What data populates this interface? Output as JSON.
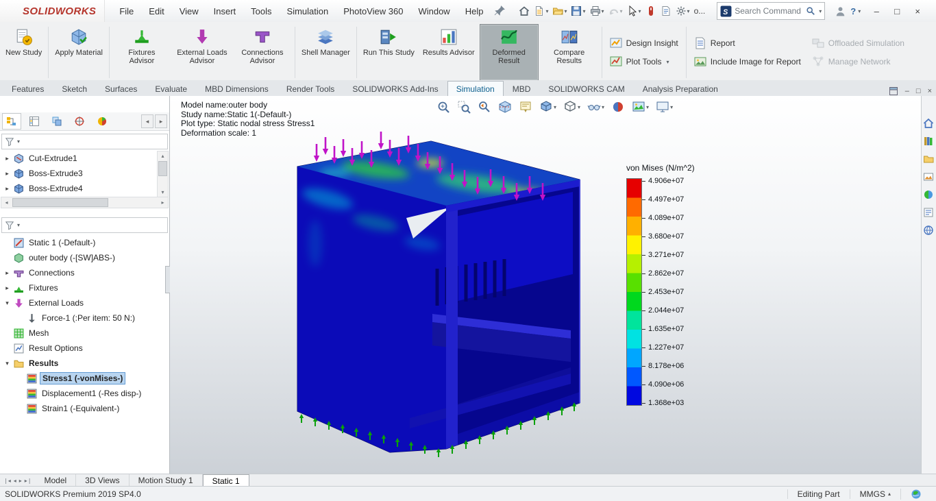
{
  "titlebar": {
    "brand": "SOLIDWORKS",
    "menu": [
      "File",
      "Edit",
      "View",
      "Insert",
      "Tools",
      "Simulation",
      "PhotoView 360",
      "Window",
      "Help"
    ],
    "quick_access": [
      {
        "icon": "home-icon",
        "name": "home-button"
      },
      {
        "icon": "new-doc-icon",
        "name": "new-document-button",
        "dropdown": true
      },
      {
        "icon": "open-icon",
        "name": "open-button",
        "dropdown": true
      },
      {
        "icon": "save-icon",
        "name": "save-button",
        "dropdown": true
      },
      {
        "icon": "print-icon",
        "name": "print-button",
        "dropdown": true
      },
      {
        "icon": "undo-icon",
        "name": "undo-button",
        "dropdown": true,
        "disabled": true
      },
      {
        "icon": "select-cursor-icon",
        "name": "select-button",
        "dropdown": true
      },
      {
        "icon": "mouse-gesture-icon",
        "name": "mouse-gestures-button"
      },
      {
        "icon": "doc-props-icon",
        "name": "file-properties-button"
      },
      {
        "icon": "gear-icon",
        "name": "options-button",
        "dropdown": true
      },
      {
        "label": "o...",
        "name": "options-overflow-button"
      }
    ],
    "search_placeholder": "Search Command"
  },
  "ribbon": {
    "large_buttons": [
      {
        "label": "New Study",
        "icon": "new-study-icon"
      },
      {
        "label": "Apply Material",
        "icon": "apply-material-icon"
      },
      {
        "label": "Fixtures Advisor",
        "icon": "fixtures-advisor-icon"
      },
      {
        "label": "External Loads Advisor",
        "icon": "external-loads-icon"
      },
      {
        "label": "Connections Advisor",
        "icon": "connections-advisor-icon"
      },
      {
        "label": "Shell Manager",
        "icon": "shell-manager-icon"
      },
      {
        "label": "Run This Study",
        "icon": "run-study-icon"
      },
      {
        "label": "Results Advisor",
        "icon": "results-advisor-icon"
      },
      {
        "label": "Deformed Result",
        "icon": "deformed-result-icon",
        "active": true
      },
      {
        "label": "Compare Results",
        "icon": "compare-results-icon"
      }
    ],
    "small_columns": [
      [
        {
          "label": "Design Insight",
          "icon": "design-insight-icon"
        },
        {
          "label": "Plot Tools",
          "icon": "plot-tools-icon",
          "dropdown": true
        }
      ],
      [
        {
          "label": "Report",
          "icon": "report-icon"
        },
        {
          "label": "Include Image for Report",
          "icon": "include-image-icon"
        }
      ],
      [
        {
          "label": "Offloaded Simulation",
          "icon": "offloaded-sim-icon",
          "disabled": true
        },
        {
          "label": "Manage Network",
          "icon": "manage-network-icon",
          "disabled": true
        }
      ]
    ]
  },
  "tabs": {
    "items": [
      "Features",
      "Sketch",
      "Surfaces",
      "Evaluate",
      "MBD Dimensions",
      "Render Tools",
      "SOLIDWORKS Add-Ins",
      "Simulation",
      "MBD",
      "SOLIDWORKS CAM",
      "Analysis Preparation"
    ],
    "active": "Simulation"
  },
  "panel": {
    "tab_icons": [
      "featuremanager-icon",
      "propertymanager-icon",
      "configurationmanager-icon",
      "dimxpert-icon",
      "displaymanager-icon"
    ],
    "feature_tree": [
      {
        "label": "Cut-Extrude1",
        "icon": "cut-extrude-icon",
        "expander": "collapsed"
      },
      {
        "label": "Boss-Extrude3",
        "icon": "boss-extrude-icon",
        "expander": "collapsed"
      },
      {
        "label": "Boss-Extrude4",
        "icon": "boss-extrude-icon",
        "expander": "collapsed"
      }
    ],
    "study_tree": [
      {
        "label": "Static 1 (-Default-)",
        "icon": "study-icon",
        "level": 0,
        "expander": "none"
      },
      {
        "label": "outer body (-[SW]ABS-)",
        "icon": "part-icon",
        "level": 0,
        "expander": "none"
      },
      {
        "label": "Connections",
        "icon": "connections-icon",
        "level": 0,
        "expander": "collapsed"
      },
      {
        "label": "Fixtures",
        "icon": "fixtures-icon",
        "level": 0,
        "expander": "collapsed"
      },
      {
        "label": "External Loads",
        "icon": "external-loads-tree-icon",
        "level": 0,
        "expander": "expanded"
      },
      {
        "label": "Force-1 (:Per item: 50 N:)",
        "icon": "force-icon",
        "level": 1,
        "expander": "none"
      },
      {
        "label": "Mesh",
        "icon": "mesh-icon",
        "level": 0,
        "expander": "none"
      },
      {
        "label": "Result Options",
        "icon": "result-options-icon",
        "level": 0,
        "expander": "none"
      },
      {
        "label": "Results",
        "icon": "results-folder-icon",
        "level": 0,
        "expander": "expanded",
        "bold": true
      },
      {
        "label": "Stress1 (-vonMises-)",
        "icon": "stress-plot-icon",
        "level": 1,
        "expander": "none",
        "selected": true,
        "bold": true
      },
      {
        "label": "Displacement1 (-Res disp-)",
        "icon": "displacement-plot-icon",
        "level": 1,
        "expander": "none"
      },
      {
        "label": "Strain1 (-Equivalent-)",
        "icon": "strain-plot-icon",
        "level": 1,
        "expander": "none"
      }
    ]
  },
  "viewport": {
    "model_info": [
      "Model name:outer body",
      "Study name:Static 1(-Default-)",
      "Plot type: Static nodal stress Stress1",
      "Deformation scale: 1"
    ],
    "toolbar": [
      {
        "icon": "zoom-fit-icon",
        "name": "zoom-to-fit-button"
      },
      {
        "icon": "zoom-area-icon",
        "name": "zoom-to-area-button"
      },
      {
        "icon": "previous-view-icon",
        "name": "previous-view-button"
      },
      {
        "icon": "section-view-icon",
        "name": "section-view-button"
      },
      {
        "icon": "dynamic-annotation-icon",
        "name": "annotation-views-button"
      },
      {
        "icon": "view-orientation-icon",
        "name": "view-orientation-button",
        "dropdown": true
      },
      {
        "icon": "display-style-icon",
        "name": "display-style-button",
        "dropdown": true
      },
      {
        "icon": "hide-show-icon",
        "name": "hide-show-items-button",
        "dropdown": true
      },
      {
        "icon": "edit-appearance-icon",
        "name": "edit-appearance-button"
      },
      {
        "icon": "apply-scene-icon",
        "name": "apply-scene-button",
        "dropdown": true
      },
      {
        "icon": "view-settings-icon",
        "name": "view-settings-button",
        "dropdown": true
      }
    ],
    "legend": {
      "title": "von Mises (N/m^2)",
      "values": [
        "4.906e+07",
        "4.497e+07",
        "4.089e+07",
        "3.680e+07",
        "3.271e+07",
        "2.862e+07",
        "2.453e+07",
        "2.044e+07",
        "1.635e+07",
        "1.227e+07",
        "8.178e+06",
        "4.090e+06",
        "1.368e+03"
      ]
    }
  },
  "taskpane": {
    "icons": [
      "resources-home-icon",
      "design-library-icon",
      "file-explorer-icon",
      "view-palette-icon",
      "appearances-icon",
      "custom-properties-icon",
      "forum-icon"
    ]
  },
  "bottom_tabs": {
    "items": [
      "Model",
      "3D Views",
      "Motion Study 1",
      "Static 1"
    ],
    "active": "Static 1"
  },
  "status": {
    "left": "SOLIDWORKS Premium 2019 SP4.0",
    "editing": "Editing Part",
    "units": "MMGS"
  }
}
